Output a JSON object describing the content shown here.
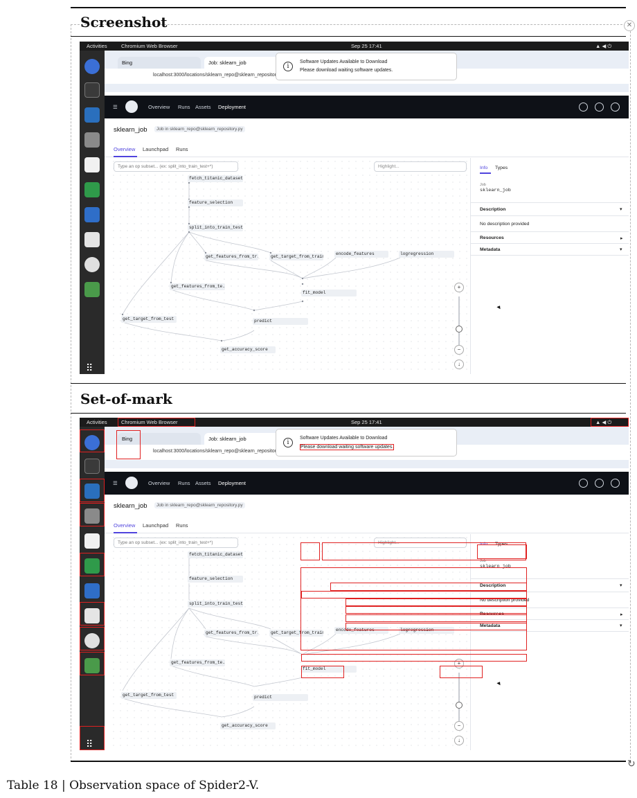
{
  "sections": {
    "screenshot_title": "Screenshot",
    "setofmark_title": "Set-of-mark"
  },
  "caption": "Table 18 | Observation space of Spider2-V.",
  "ui": {
    "topbar": {
      "activities": "Activities",
      "app": "Chromium Web Browser",
      "clock": "Sep 25  17:41"
    },
    "tabs": {
      "tab1": "Bing",
      "tab2": "Job: sklearn_job"
    },
    "url": "localhost:3000/locations/sklearn_repo@sklearn_repository.py/jobs/sklearn_job",
    "notification": {
      "title": "Software Updates Available to Download",
      "body": "Please download waiting software updates."
    },
    "nav": {
      "overview": "Overview",
      "runs": "Runs",
      "assets": "Assets",
      "deployment": "Deployment"
    },
    "job": {
      "title": "sklearn_job",
      "location": "Job in sklearn_repo@sklearn_repository.py"
    },
    "subtabs": {
      "overview": "Overview",
      "launchpad": "Launchpad",
      "runs": "Runs"
    },
    "filter_placeholder": "Type an op subset... (ex: split_into_train_test+*)",
    "highlight_placeholder": "Highlight...",
    "nodes": {
      "n1": "fetch_titanic_dataset",
      "n2": "feature_selection",
      "n3": "split_into_train_test",
      "n4": "get_features_from_tr...",
      "n5": "get_target_from_train",
      "n6": "encode_features",
      "n7": "logregression",
      "n8": "get_features_from_te...",
      "n9": "fit_model",
      "n10": "get_target_from_test",
      "n11": "predict",
      "n12": "get_accuracy_score"
    },
    "side": {
      "tab_info": "Info",
      "tab_types": "Types",
      "job_label": "Job",
      "job_name": "sklearn_job",
      "description": "Description",
      "no_desc": "No description provided",
      "resources": "Resources",
      "metadata": "Metadata"
    }
  }
}
